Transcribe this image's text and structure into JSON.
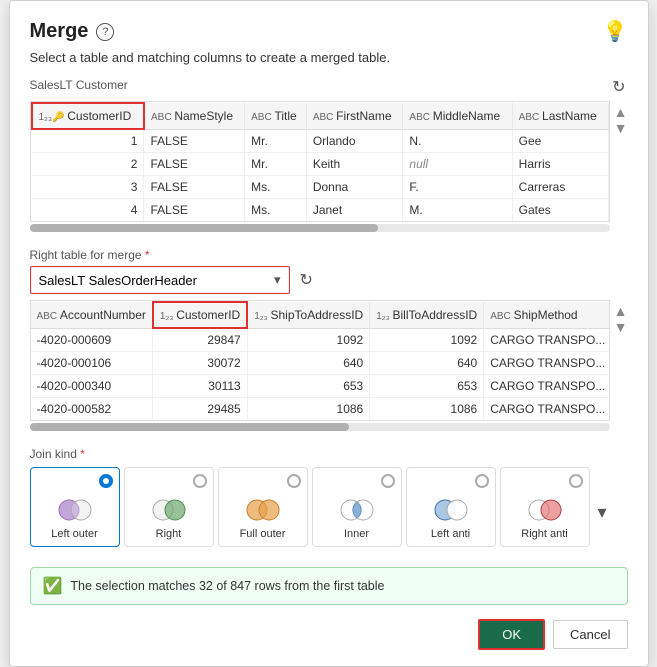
{
  "dialog": {
    "title": "Merge",
    "subtitle": "Select a table and matching columns to create a merged table.",
    "help_label": "?",
    "bulb_label": "💡"
  },
  "top_table": {
    "name": "SalesLT Customer",
    "columns": [
      {
        "id": "CustomerID",
        "type": "123🔑",
        "label": "CustomerID",
        "highlight": true
      },
      {
        "id": "NameStyle",
        "type": "ABC",
        "label": "NameStyle",
        "highlight": false
      },
      {
        "id": "Title",
        "type": "ABC",
        "label": "Title",
        "highlight": false
      },
      {
        "id": "FirstName",
        "type": "ABC",
        "label": "FirstName",
        "highlight": false
      },
      {
        "id": "MiddleName",
        "type": "ABC",
        "label": "MiddleName",
        "highlight": false
      },
      {
        "id": "LastName",
        "type": "ABC",
        "label": "LastName",
        "highlight": false
      }
    ],
    "rows": [
      {
        "CustomerID": "1",
        "NameStyle": "FALSE",
        "Title": "Mr.",
        "FirstName": "Orlando",
        "MiddleName": "N.",
        "LastName": "Gee"
      },
      {
        "CustomerID": "2",
        "NameStyle": "FALSE",
        "Title": "Mr.",
        "FirstName": "Keith",
        "MiddleName": "null",
        "LastName": "Harris"
      },
      {
        "CustomerID": "3",
        "NameStyle": "FALSE",
        "Title": "Ms.",
        "FirstName": "Donna",
        "MiddleName": "F.",
        "LastName": "Carreras"
      },
      {
        "CustomerID": "4",
        "NameStyle": "FALSE",
        "Title": "Ms.",
        "FirstName": "Janet",
        "MiddleName": "M.",
        "LastName": "Gates"
      }
    ]
  },
  "right_table_label": "Right table for merge",
  "right_table_required": "*",
  "right_table_selected": "SalesLT SalesOrderHeader",
  "bottom_table": {
    "columns": [
      {
        "id": "AccountNumber",
        "type": "ABC",
        "label": "AccountNumber",
        "highlight": false
      },
      {
        "id": "CustomerID",
        "type": "123",
        "label": "CustomerID",
        "highlight": true
      },
      {
        "id": "ShipToAddressID",
        "type": "123",
        "label": "ShipToAddressID",
        "highlight": false
      },
      {
        "id": "BillToAddressID",
        "type": "123",
        "label": "BillToAddressID",
        "highlight": false
      },
      {
        "id": "ShipMethod",
        "type": "ABC",
        "label": "ShipMethod",
        "highlight": false
      }
    ],
    "rows": [
      {
        "AccountNumber": "-4020-000609",
        "CustomerID": "29847",
        "ShipToAddressID": "1092",
        "BillToAddressID": "1092",
        "ShipMethod": "CARGO TRANSPO..."
      },
      {
        "AccountNumber": "-4020-000106",
        "CustomerID": "30072",
        "ShipToAddressID": "640",
        "BillToAddressID": "640",
        "ShipMethod": "CARGO TRANSPO..."
      },
      {
        "AccountNumber": "-4020-000340",
        "CustomerID": "30113",
        "ShipToAddressID": "653",
        "BillToAddressID": "653",
        "ShipMethod": "CARGO TRANSPO..."
      },
      {
        "AccountNumber": "-4020-000582",
        "CustomerID": "29485",
        "ShipToAddressID": "1086",
        "BillToAddressID": "1086",
        "ShipMethod": "CARGO TRANSPO..."
      }
    ]
  },
  "join_kind_label": "Join kind",
  "join_kinds": [
    {
      "id": "left-outer",
      "label": "Left outer",
      "selected": true
    },
    {
      "id": "right",
      "label": "Right",
      "selected": false
    },
    {
      "id": "full-outer",
      "label": "Full outer",
      "selected": false
    },
    {
      "id": "inner",
      "label": "Inner",
      "selected": false
    },
    {
      "id": "left-anti",
      "label": "Left anti",
      "selected": false
    },
    {
      "id": "right-anti",
      "label": "Right anti",
      "selected": false
    }
  ],
  "success_message": "The selection matches 32 of 847 rows from the ",
  "success_highlight": "first table",
  "buttons": {
    "ok": "OK",
    "cancel": "Cancel"
  }
}
